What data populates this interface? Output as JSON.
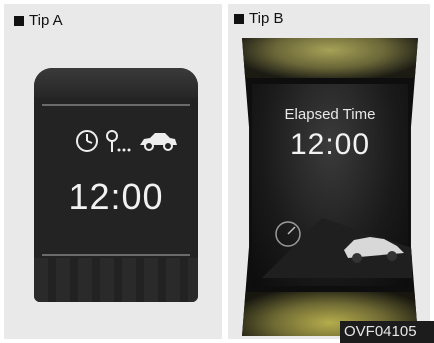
{
  "type_a": {
    "label": "Tip A",
    "clock": "12:00"
  },
  "type_b": {
    "label": "Tip B",
    "title": "Elapsed Time",
    "clock": "12:00"
  },
  "figure_code": "OVF04105",
  "icons": [
    "clock-icon",
    "key-icon",
    "car-icon",
    "speedometer-icon",
    "car-icon"
  ]
}
